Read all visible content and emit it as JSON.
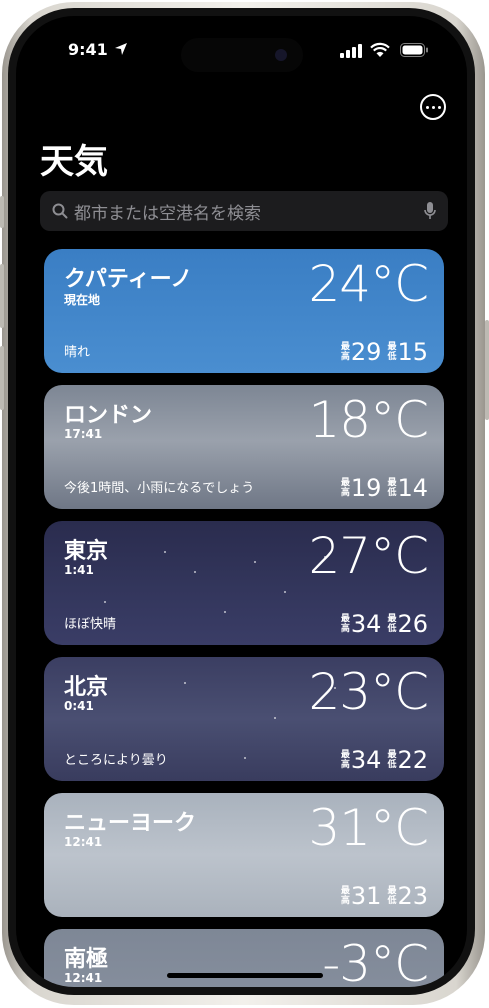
{
  "status": {
    "time": "9:41"
  },
  "app": {
    "title": "天気"
  },
  "search": {
    "placeholder": "都市または空港名を検索"
  },
  "labels": {
    "high": [
      "最",
      "高"
    ],
    "low": [
      "最",
      "低"
    ]
  },
  "cities": [
    {
      "name": "クパティーノ",
      "sub": "現在地",
      "temp": "24°C",
      "condition": "晴れ",
      "high": "29",
      "low": "15"
    },
    {
      "name": "ロンドン",
      "sub": "17:41",
      "temp": "18°C",
      "condition": "今後1時間、小雨になるでしょう",
      "high": "19",
      "low": "14"
    },
    {
      "name": "東京",
      "sub": "1:41",
      "temp": "27°C",
      "condition": "ほぼ快晴",
      "high": "34",
      "low": "26"
    },
    {
      "name": "北京",
      "sub": "0:41",
      "temp": "23°C",
      "condition": "ところにより曇り",
      "high": "34",
      "low": "22"
    },
    {
      "name": "ニューヨーク",
      "sub": "12:41",
      "temp": "31°C",
      "condition": "",
      "high": "31",
      "low": "23"
    },
    {
      "name": "南極",
      "sub": "12:41",
      "temp": "-3°C"
    }
  ],
  "colors": {
    "accent_blue": "#3b7fc4"
  }
}
